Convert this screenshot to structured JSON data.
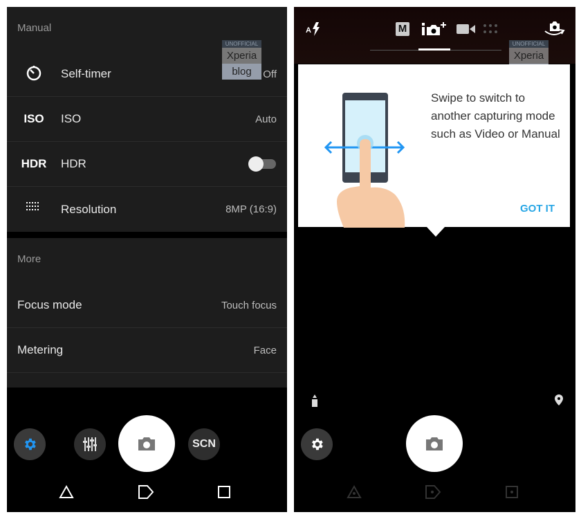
{
  "left": {
    "manual_header": "Manual",
    "rows": [
      {
        "icon": "timer-icon",
        "label": "Self-timer",
        "value": "Off"
      },
      {
        "icon": "iso-icon",
        "icon_text": "ISO",
        "label": "ISO",
        "value": "Auto"
      },
      {
        "icon": "hdr-icon",
        "icon_text": "HDR",
        "label": "HDR",
        "toggle": false
      },
      {
        "icon": "resolution-grid-icon",
        "label": "Resolution",
        "value": "8MP (16:9)"
      }
    ],
    "more_header": "More",
    "more_rows": [
      {
        "label": "Focus mode",
        "value": "Touch focus"
      },
      {
        "label": "Metering",
        "value": "Face"
      }
    ],
    "scn_label": "SCN",
    "accent": "#2196f3"
  },
  "right": {
    "mode_m": "M",
    "tooltip_text": "Swipe to switch to another capturing mode such as Video or Manual",
    "got_it": "GOT IT",
    "accent": "#27a6e5"
  },
  "watermark": {
    "top": "UNOFFICIAL",
    "mid": "Xperia",
    "bottom": "blog"
  }
}
